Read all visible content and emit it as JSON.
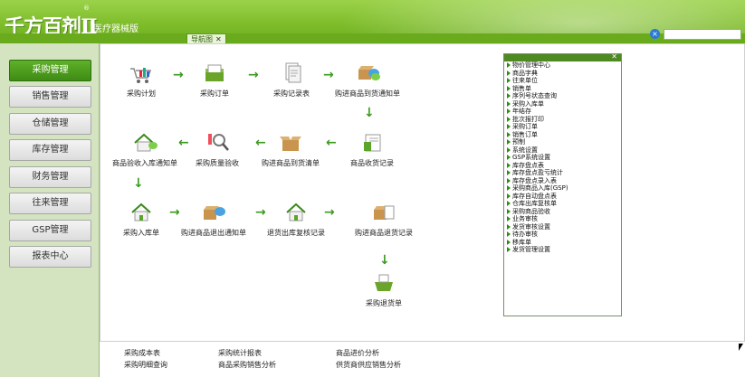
{
  "header": {
    "logo": "千方百剂Ⅱ",
    "logo_sub": "医疗器械版",
    "reg": "®",
    "tab_label": "导航图",
    "tab_close": "✕"
  },
  "sidebar": {
    "items": [
      {
        "label": "采购管理",
        "active": true
      },
      {
        "label": "销售管理",
        "active": false
      },
      {
        "label": "仓储管理",
        "active": false
      },
      {
        "label": "库存管理",
        "active": false
      },
      {
        "label": "财务管理",
        "active": false
      },
      {
        "label": "往来管理",
        "active": false
      },
      {
        "label": "GSP管理",
        "active": false
      },
      {
        "label": "报表中心",
        "active": false
      }
    ]
  },
  "flow": {
    "nodes": [
      {
        "label": "采购计划"
      },
      {
        "label": "采购订单"
      },
      {
        "label": "采购记录表"
      },
      {
        "label": "购进商品到货通知单"
      },
      {
        "label": "商品收货记录"
      },
      {
        "label": "购进商品到货清单"
      },
      {
        "label": "采购质量验收"
      },
      {
        "label": "商品验收入库通知单"
      },
      {
        "label": "采购入库单"
      },
      {
        "label": "购进商品退出通知单"
      },
      {
        "label": "退货出库复核记录"
      },
      {
        "label": "购进商品退货记录"
      },
      {
        "label": "采购退货单"
      }
    ],
    "arrow_right": "→",
    "arrow_left": "←",
    "arrow_down": "↓"
  },
  "menu": {
    "close": "✕",
    "items": [
      "物价管理中心",
      "商品字典",
      "往来单位",
      "销售单",
      "序列号状态查询",
      "采购入库单",
      "年结存",
      "批次报打印",
      "采购订单",
      "销售订单",
      "预制",
      "系统设置",
      "GSP系统设置",
      "库存盘点表",
      "库存盘点盈亏统计",
      "库存盘点录入表",
      "采购商品入库(GSP)",
      "库存自动盘点表",
      "仓库出库复核单",
      "采购商品验收",
      "业务审核",
      "发货审核设置",
      "待办审核",
      "移库单",
      "发货管理设置"
    ]
  },
  "footer": {
    "links": [
      "采购成本表",
      "采购统计报表",
      "商品进价分析",
      "采购明细查询",
      "商品采购销售分析",
      "供货商供应销售分析"
    ]
  },
  "colors": {
    "brand_green": "#6aab1d",
    "accent_blue": "#2a7ad6",
    "arrow_green": "#3b9a1f"
  }
}
